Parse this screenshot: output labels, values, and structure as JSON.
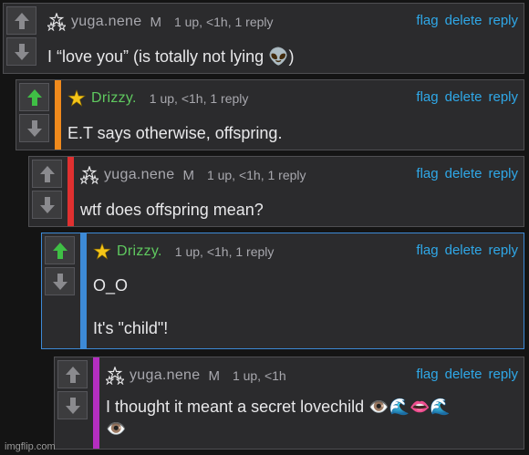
{
  "colors": {
    "bar_orange": "#f08a1c",
    "bar_red": "#e03030",
    "bar_blue": "#3d8ad6",
    "bar_purple": "#b42ec0",
    "link_blue": "#2fa8e8",
    "upvote_green": "#3fbf45",
    "username_green": "#5fc85f"
  },
  "comments": [
    {
      "username": "yuga.nene",
      "mod_flag": "M",
      "info": "1 up, <1h, 1 reply",
      "actions": {
        "flag": "flag",
        "delete": "delete",
        "reply": "reply"
      },
      "text": "I “love you” (is totally not lying 👽)"
    },
    {
      "username": "Drizzy.",
      "info": "1 up, <1h, 1 reply",
      "actions": {
        "flag": "flag",
        "delete": "delete",
        "reply": "reply"
      },
      "text": "E.T says otherwise, offspring."
    },
    {
      "username": "yuga.nene",
      "mod_flag": "M",
      "info": "1 up, <1h, 1 reply",
      "actions": {
        "flag": "flag",
        "delete": "delete",
        "reply": "reply"
      },
      "text": "wtf does offspring mean?"
    },
    {
      "username": "Drizzy.",
      "info": "1 up, <1h, 1 reply",
      "actions": {
        "flag": "flag",
        "delete": "delete",
        "reply": "reply"
      },
      "text_line1": "O_O",
      "text_line2": "It's \"child\"!"
    },
    {
      "username": "yuga.nene",
      "mod_flag": "M",
      "info": "1 up, <1h",
      "actions": {
        "flag": "flag",
        "delete": "delete",
        "reply": "reply"
      },
      "text_line1": "I thought it meant a secret lovechild 👁️🌊👄🌊",
      "text_line2": "👁️"
    }
  ],
  "watermark": "imgflip.com"
}
